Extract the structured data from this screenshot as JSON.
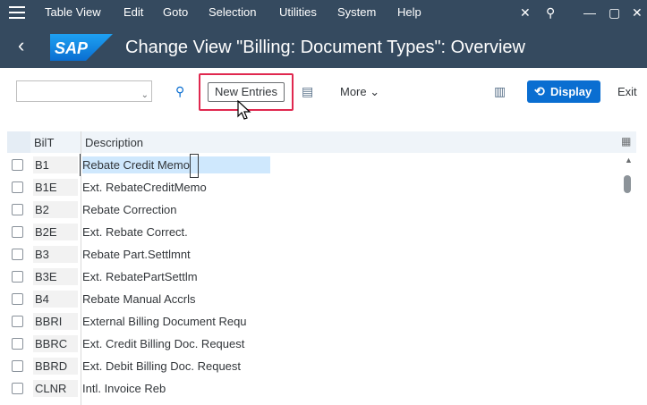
{
  "menubar": {
    "items": [
      "Table View",
      "Edit",
      "Goto",
      "Selection",
      "Utilities",
      "System",
      "Help"
    ]
  },
  "titlebar": {
    "logo_text": "SAP",
    "title": "Change View \"Billing: Document Types\": Overview"
  },
  "toolbar": {
    "new_entries": "New Entries",
    "more": "More",
    "display": "Display",
    "exit": "Exit"
  },
  "table": {
    "headers": [
      "BilT",
      "Description"
    ],
    "rows": [
      {
        "bilt": "B1",
        "desc": "Rebate Credit Memo",
        "selected": true
      },
      {
        "bilt": "B1E",
        "desc": "Ext. RebateCreditMemo"
      },
      {
        "bilt": "B2",
        "desc": "Rebate Correction"
      },
      {
        "bilt": "B2E",
        "desc": "Ext. Rebate Correct."
      },
      {
        "bilt": "B3",
        "desc": "Rebate Part.Settlmnt"
      },
      {
        "bilt": "B3E",
        "desc": "Ext. RebatePartSettlm"
      },
      {
        "bilt": "B4",
        "desc": "Rebate Manual Accrls"
      },
      {
        "bilt": "BBRI",
        "desc": "External Billing Document Requ"
      },
      {
        "bilt": "BBRC",
        "desc": "Ext. Credit Billing Doc. Request"
      },
      {
        "bilt": "BBRD",
        "desc": "Ext. Debit Billing Doc. Request"
      },
      {
        "bilt": "CLNR",
        "desc": "Intl. Invoice Reb"
      }
    ]
  }
}
